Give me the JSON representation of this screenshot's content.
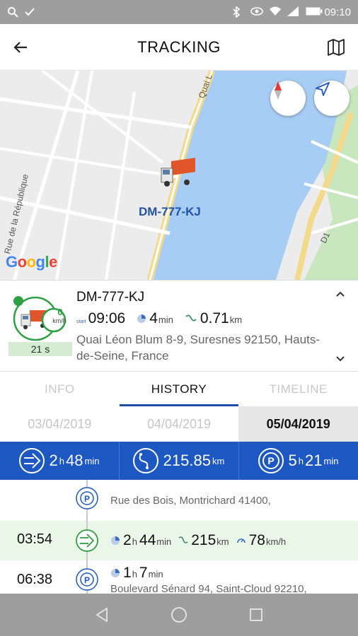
{
  "status_bar": {
    "time": "09:10"
  },
  "appbar": {
    "title": "TRACKING"
  },
  "map": {
    "plate": "DM-777-KJ",
    "street_labels": [
      "Rue de la République",
      "Quai L",
      "D1"
    ],
    "attribution": "Google"
  },
  "vehicle": {
    "name": "DM-777-KJ",
    "speed": "0",
    "speed_unit": "km/h",
    "delay": "21 s",
    "start_label": "start",
    "time": "09:06",
    "duration_value": "4",
    "duration_unit": "min",
    "distance_value": "0.71",
    "distance_unit": "km",
    "address": "Quai Léon Blum 8-9, Suresnes 92150, Hauts-de-Seine, France"
  },
  "tabs": [
    {
      "label": "INFO",
      "active": false
    },
    {
      "label": "HISTORY",
      "active": true
    },
    {
      "label": "TIMELINE",
      "active": false
    }
  ],
  "dates": [
    "03/04/2019",
    "04/04/2019",
    "05/04/2019"
  ],
  "summary": {
    "driving_h": "2",
    "driving_min": "48",
    "h_unit": "h",
    "min_unit": "min",
    "distance": "215.85",
    "distance_unit": "km",
    "parking_h": "5",
    "parking_min": "21"
  },
  "timeline": [
    {
      "time": "",
      "type": "parking",
      "text": "Rue des Bois, Montrichard 41400,"
    },
    {
      "time": "03:54",
      "type": "driving",
      "duration_h": "2",
      "duration_min": "44",
      "distance": "215",
      "distance_unit": "km",
      "speed": "78",
      "speed_unit": "km/h"
    },
    {
      "time": "06:38",
      "type": "parking",
      "duration_h": "1",
      "duration_min": "7",
      "text": "Boulevard Sénard 94, Saint-Cloud 92210,"
    }
  ],
  "colors": {
    "primary": "#1d57c2",
    "accent_green": "#2ea043",
    "water": "#a8cdf4",
    "park": "#c9e7bf"
  }
}
